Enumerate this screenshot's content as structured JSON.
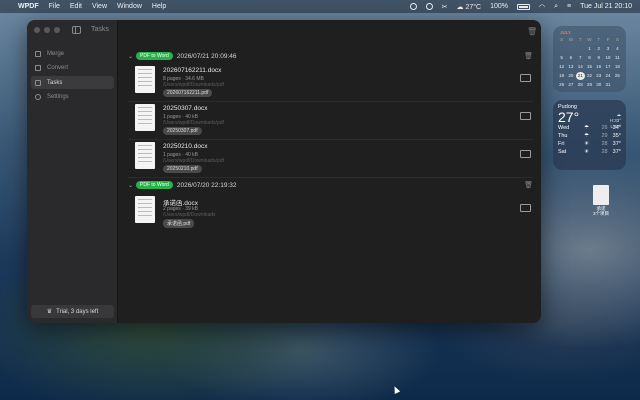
{
  "menubar": {
    "app_name": "WPDF",
    "menus": [
      "File",
      "Edit",
      "View",
      "Window",
      "Help"
    ],
    "temperature": "27°C",
    "battery": "100%",
    "datetime": "Tue Jul 21  20:10"
  },
  "window": {
    "title": "Tasks"
  },
  "sidebar": {
    "items": [
      {
        "label": "Merge"
      },
      {
        "label": "Convert"
      },
      {
        "label": "Tasks"
      },
      {
        "label": "Settings"
      }
    ],
    "trial_label": "Trial, 3 days left"
  },
  "groups": [
    {
      "tag": "PDF to Word",
      "datetime": "2026/07/21 20:09:46",
      "files": [
        {
          "name": "202607162211.docx",
          "meta": "8 pages · 34.6 MB",
          "path": "/Users/wpdf/Downloads/pdf",
          "source": "202607162211.pdf"
        },
        {
          "name": "20250307.docx",
          "meta": "1 pages · 40 kB",
          "path": "/Users/wpdf/Downloads/pdf",
          "source": "20250307.pdf"
        },
        {
          "name": "20250210.docx",
          "meta": "1 pages · 40 kB",
          "path": "/Users/wpdf/Downloads/pdf",
          "source": "20250210.pdf"
        }
      ]
    },
    {
      "tag": "PDF to Word",
      "datetime": "2026/07/20 22:19:32",
      "files": [
        {
          "name": "承诺函.docx",
          "meta": "2 pages · 39 kB",
          "path": "/Users/wpdf/Downloads",
          "source": "承诺函.pdf"
        }
      ]
    }
  ],
  "calendar": {
    "month": "JULY",
    "weekdays": [
      "S",
      "M",
      "T",
      "W",
      "T",
      "F",
      "S"
    ],
    "today": "21",
    "days": [
      "",
      "",
      "",
      "1",
      "2",
      "3",
      "4",
      "5",
      "6",
      "7",
      "8",
      "9",
      "10",
      "11",
      "12",
      "13",
      "14",
      "15",
      "16",
      "17",
      "18",
      "19",
      "20",
      "21",
      "22",
      "23",
      "24",
      "25",
      "26",
      "27",
      "28",
      "29",
      "30",
      "31",
      ""
    ]
  },
  "weather": {
    "city": "Pudong",
    "temp": "27°",
    "hi": "H:33°",
    "lo": "L:27°",
    "forecast": [
      {
        "day": "Wed",
        "lo": "26",
        "hi": "34°"
      },
      {
        "day": "Thu",
        "lo": "29",
        "hi": "35°"
      },
      {
        "day": "Fri",
        "lo": "28",
        "hi": "37°"
      },
      {
        "day": "Sat",
        "lo": "28",
        "hi": "37°"
      }
    ]
  },
  "desktop": {
    "file_label": "承诺\n3个项目"
  }
}
